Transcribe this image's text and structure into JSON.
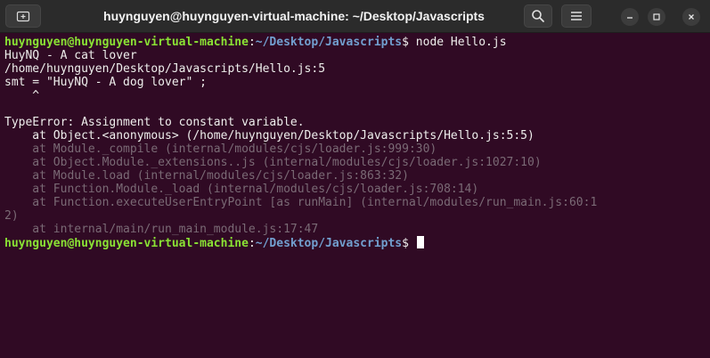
{
  "window": {
    "title": "huynguyen@huynguyen-virtual-machine: ~/Desktop/Javascripts",
    "icons": {
      "new_tab": "new-tab-icon",
      "search": "search-icon",
      "menu": "hamburger-menu-icon",
      "minimize": "minimize-icon",
      "maximize": "maximize-icon",
      "close": "close-icon"
    }
  },
  "colors": {
    "background": "#300a24",
    "prompt_user": "#8ae234",
    "prompt_path": "#729fcf",
    "text": "#eeeeec",
    "dim_text": "#7a6a75"
  },
  "prompt": {
    "user": "huynguyen@huynguyen-virtual-machine",
    "colon": ":",
    "path": "~/Desktop/Javascripts",
    "symbol": "$"
  },
  "terminal": {
    "command": " node Hello.js",
    "output_lines": [
      "HuyNQ - A cat lover",
      "/home/huynguyen/Desktop/Javascripts/Hello.js:5",
      "smt = \"HuyNQ - A dog lover\" ;",
      "    ^",
      "",
      "TypeError: Assignment to constant variable.",
      "    at Object.<anonymous> (/home/huynguyen/Desktop/Javascripts/Hello.js:5:5)"
    ],
    "stack_dim_lines": [
      "    at Module._compile (internal/modules/cjs/loader.js:999:30)",
      "    at Object.Module._extensions..js (internal/modules/cjs/loader.js:1027:10)",
      "    at Module.load (internal/modules/cjs/loader.js:863:32)",
      "    at Function.Module._load (internal/modules/cjs/loader.js:708:14)",
      "    at Function.executeUserEntryPoint [as runMain] (internal/modules/run_main.js:60:1",
      "2)",
      "    at internal/main/run_main_module.js:17:47"
    ]
  }
}
